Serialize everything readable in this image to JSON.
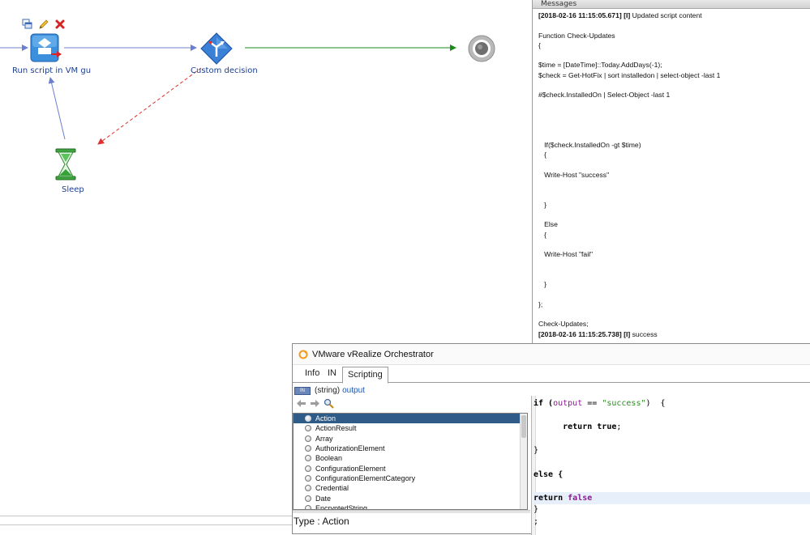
{
  "workflow": {
    "nodes": {
      "script": {
        "label": "Run script in VM gu"
      },
      "decision": {
        "label": "Custom decision"
      },
      "sleep": {
        "label": "Sleep"
      },
      "end": {
        "label": ""
      }
    },
    "node_icons": [
      "window-icon",
      "pencil-icon",
      "close-icon",
      "script-node-icon",
      "decision-node-icon",
      "hourglass-icon",
      "end-node-icon"
    ],
    "colors": {
      "link": "#6b7fd0",
      "success": "#1b8a1b",
      "error": "#e03030"
    }
  },
  "messages": {
    "header": "Messages",
    "lines": [
      {
        "ts": "[2018-02-16 11:15:05.671] [I]",
        "text": " Updated script content"
      },
      {
        "ts": "",
        "text": ""
      },
      {
        "ts": "",
        "text": "Function Check-Updates"
      },
      {
        "ts": "",
        "text": "{"
      },
      {
        "ts": "",
        "text": ""
      },
      {
        "ts": "",
        "text": "$time = [DateTime]::Today.AddDays(-1);"
      },
      {
        "ts": "",
        "text": "$check = Get-HotFix | sort installedon | select-object -last 1"
      },
      {
        "ts": "",
        "text": ""
      },
      {
        "ts": "",
        "text": "#$check.InstalledOn | Select-Object -last 1"
      },
      {
        "ts": "",
        "text": ""
      },
      {
        "ts": "",
        "text": ""
      },
      {
        "ts": "",
        "text": ""
      },
      {
        "ts": "",
        "text": ""
      },
      {
        "ts": "",
        "text": "   If($check.InstalledOn -gt $time)"
      },
      {
        "ts": "",
        "text": "   {"
      },
      {
        "ts": "",
        "text": ""
      },
      {
        "ts": "",
        "text": "   Write-Host \"success\""
      },
      {
        "ts": "",
        "text": ""
      },
      {
        "ts": "",
        "text": ""
      },
      {
        "ts": "",
        "text": "   }"
      },
      {
        "ts": "",
        "text": ""
      },
      {
        "ts": "",
        "text": "   Else"
      },
      {
        "ts": "",
        "text": "   {"
      },
      {
        "ts": "",
        "text": ""
      },
      {
        "ts": "",
        "text": "   Write-Host \"fail\""
      },
      {
        "ts": "",
        "text": ""
      },
      {
        "ts": "",
        "text": ""
      },
      {
        "ts": "",
        "text": "   }"
      },
      {
        "ts": "",
        "text": ""
      },
      {
        "ts": "",
        "text": "};"
      },
      {
        "ts": "",
        "text": ""
      },
      {
        "ts": "",
        "text": "Check-Updates;"
      },
      {
        "ts": "[2018-02-16 11:15:25.738] [I]",
        "text": " success"
      }
    ]
  },
  "dialog": {
    "title": "VMware vRealize Orchestrator",
    "tabs": [
      {
        "label": "Info"
      },
      {
        "label": "IN"
      },
      {
        "label": "Scripting"
      }
    ],
    "active_tab": "Scripting",
    "output_badge": "IN",
    "output_type": "(string)",
    "output_name": "output",
    "types": [
      "Action",
      "ActionResult",
      "Array",
      "AuthorizationElement",
      "Boolean",
      "ConfigurationElement",
      "ConfigurationElementCategory",
      "Credential",
      "Date",
      "EncryptedString"
    ],
    "selected_type": "Action",
    "type_info": "Type : Action",
    "code": {
      "l1a": "if (",
      "l1b": "output",
      "l1c": " == ",
      "l1d": "\"success\"",
      "l1e": ")  {",
      "l2a": "      return ",
      "l2b": "true",
      "l2c": ";",
      "l3": "}",
      "l4": "else {",
      "l5a": "return ",
      "l5b": "false",
      "l6": "}",
      "l7": ";"
    }
  }
}
